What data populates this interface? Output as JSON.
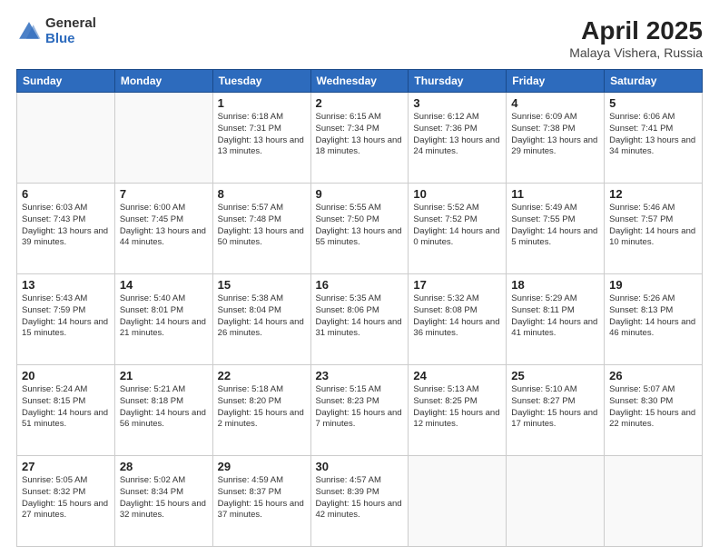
{
  "header": {
    "logo_general": "General",
    "logo_blue": "Blue",
    "title": "April 2025",
    "subtitle": "Malaya Vishera, Russia"
  },
  "weekdays": [
    "Sunday",
    "Monday",
    "Tuesday",
    "Wednesday",
    "Thursday",
    "Friday",
    "Saturday"
  ],
  "weeks": [
    [
      {
        "day": "",
        "info": ""
      },
      {
        "day": "",
        "info": ""
      },
      {
        "day": "1",
        "info": "Sunrise: 6:18 AM\nSunset: 7:31 PM\nDaylight: 13 hours and 13 minutes."
      },
      {
        "day": "2",
        "info": "Sunrise: 6:15 AM\nSunset: 7:34 PM\nDaylight: 13 hours and 18 minutes."
      },
      {
        "day": "3",
        "info": "Sunrise: 6:12 AM\nSunset: 7:36 PM\nDaylight: 13 hours and 24 minutes."
      },
      {
        "day": "4",
        "info": "Sunrise: 6:09 AM\nSunset: 7:38 PM\nDaylight: 13 hours and 29 minutes."
      },
      {
        "day": "5",
        "info": "Sunrise: 6:06 AM\nSunset: 7:41 PM\nDaylight: 13 hours and 34 minutes."
      }
    ],
    [
      {
        "day": "6",
        "info": "Sunrise: 6:03 AM\nSunset: 7:43 PM\nDaylight: 13 hours and 39 minutes."
      },
      {
        "day": "7",
        "info": "Sunrise: 6:00 AM\nSunset: 7:45 PM\nDaylight: 13 hours and 44 minutes."
      },
      {
        "day": "8",
        "info": "Sunrise: 5:57 AM\nSunset: 7:48 PM\nDaylight: 13 hours and 50 minutes."
      },
      {
        "day": "9",
        "info": "Sunrise: 5:55 AM\nSunset: 7:50 PM\nDaylight: 13 hours and 55 minutes."
      },
      {
        "day": "10",
        "info": "Sunrise: 5:52 AM\nSunset: 7:52 PM\nDaylight: 14 hours and 0 minutes."
      },
      {
        "day": "11",
        "info": "Sunrise: 5:49 AM\nSunset: 7:55 PM\nDaylight: 14 hours and 5 minutes."
      },
      {
        "day": "12",
        "info": "Sunrise: 5:46 AM\nSunset: 7:57 PM\nDaylight: 14 hours and 10 minutes."
      }
    ],
    [
      {
        "day": "13",
        "info": "Sunrise: 5:43 AM\nSunset: 7:59 PM\nDaylight: 14 hours and 15 minutes."
      },
      {
        "day": "14",
        "info": "Sunrise: 5:40 AM\nSunset: 8:01 PM\nDaylight: 14 hours and 21 minutes."
      },
      {
        "day": "15",
        "info": "Sunrise: 5:38 AM\nSunset: 8:04 PM\nDaylight: 14 hours and 26 minutes."
      },
      {
        "day": "16",
        "info": "Sunrise: 5:35 AM\nSunset: 8:06 PM\nDaylight: 14 hours and 31 minutes."
      },
      {
        "day": "17",
        "info": "Sunrise: 5:32 AM\nSunset: 8:08 PM\nDaylight: 14 hours and 36 minutes."
      },
      {
        "day": "18",
        "info": "Sunrise: 5:29 AM\nSunset: 8:11 PM\nDaylight: 14 hours and 41 minutes."
      },
      {
        "day": "19",
        "info": "Sunrise: 5:26 AM\nSunset: 8:13 PM\nDaylight: 14 hours and 46 minutes."
      }
    ],
    [
      {
        "day": "20",
        "info": "Sunrise: 5:24 AM\nSunset: 8:15 PM\nDaylight: 14 hours and 51 minutes."
      },
      {
        "day": "21",
        "info": "Sunrise: 5:21 AM\nSunset: 8:18 PM\nDaylight: 14 hours and 56 minutes."
      },
      {
        "day": "22",
        "info": "Sunrise: 5:18 AM\nSunset: 8:20 PM\nDaylight: 15 hours and 2 minutes."
      },
      {
        "day": "23",
        "info": "Sunrise: 5:15 AM\nSunset: 8:23 PM\nDaylight: 15 hours and 7 minutes."
      },
      {
        "day": "24",
        "info": "Sunrise: 5:13 AM\nSunset: 8:25 PM\nDaylight: 15 hours and 12 minutes."
      },
      {
        "day": "25",
        "info": "Sunrise: 5:10 AM\nSunset: 8:27 PM\nDaylight: 15 hours and 17 minutes."
      },
      {
        "day": "26",
        "info": "Sunrise: 5:07 AM\nSunset: 8:30 PM\nDaylight: 15 hours and 22 minutes."
      }
    ],
    [
      {
        "day": "27",
        "info": "Sunrise: 5:05 AM\nSunset: 8:32 PM\nDaylight: 15 hours and 27 minutes."
      },
      {
        "day": "28",
        "info": "Sunrise: 5:02 AM\nSunset: 8:34 PM\nDaylight: 15 hours and 32 minutes."
      },
      {
        "day": "29",
        "info": "Sunrise: 4:59 AM\nSunset: 8:37 PM\nDaylight: 15 hours and 37 minutes."
      },
      {
        "day": "30",
        "info": "Sunrise: 4:57 AM\nSunset: 8:39 PM\nDaylight: 15 hours and 42 minutes."
      },
      {
        "day": "",
        "info": ""
      },
      {
        "day": "",
        "info": ""
      },
      {
        "day": "",
        "info": ""
      }
    ]
  ]
}
